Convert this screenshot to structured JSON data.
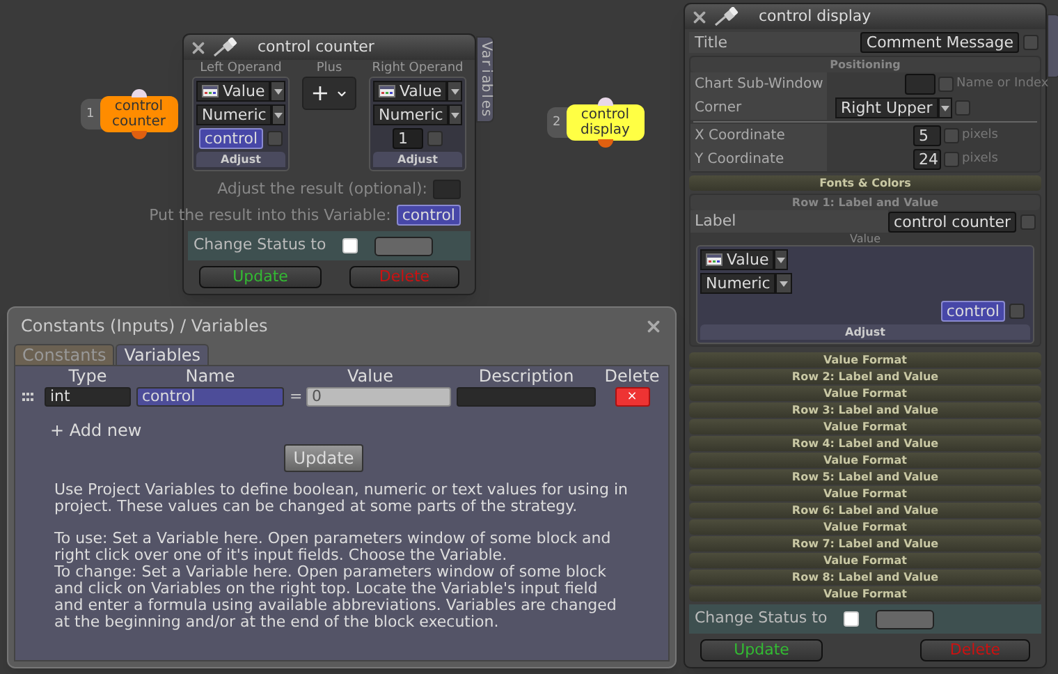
{
  "nodes": [
    {
      "number": "1",
      "label": "control counter",
      "color": "#ff8c00"
    },
    {
      "number": "2",
      "label": "control display",
      "color": "#ffff44"
    }
  ],
  "counter_window": {
    "title": "control counter",
    "side_tab": "Variables",
    "left_operand": {
      "heading": "Left Operand",
      "source": "Value",
      "type": "Numeric",
      "value": "control",
      "kind": "variable",
      "checked": false,
      "adjust": "Adjust"
    },
    "operation": {
      "heading": "Plus",
      "symbol": "+"
    },
    "right_operand": {
      "heading": "Right Operand",
      "source": "Value",
      "type": "Numeric",
      "value": "1",
      "kind": "number",
      "checked": false,
      "adjust": "Adjust"
    },
    "adjust_label": "Adjust the result (optional):",
    "result_label": "Put the result into this Variable:",
    "result_variable": "control",
    "status": {
      "label": "Change Status to",
      "checked": false
    },
    "buttons": [
      {
        "label": "Update",
        "kind": "update"
      },
      {
        "label": "Delete",
        "kind": "delete"
      }
    ]
  },
  "display_window": {
    "title": "control display",
    "title_row": {
      "label": "Title",
      "value": "Comment Message",
      "checked": false
    },
    "positioning": {
      "heading": "Positioning",
      "rows": [
        {
          "kind": "field",
          "label": "Chart Sub-Window",
          "checked": false,
          "hint": "Name or Index"
        },
        {
          "kind": "select",
          "label": "Corner",
          "value": "Right Upper",
          "checked": false
        },
        {
          "kind": "number",
          "label": "X Coordinate",
          "value": "5",
          "checked": false,
          "hint": "pixels"
        },
        {
          "kind": "number",
          "label": "Y Coordinate",
          "value": "24",
          "checked": false,
          "hint": "pixels"
        }
      ]
    },
    "fonts_heading": "Fonts & Colors",
    "row1": {
      "heading": "Row 1: Label and Value",
      "label": "Label",
      "label_value": "control counter",
      "checked": false,
      "value_caption": "Value",
      "source": "Value",
      "type": "Numeric",
      "variable": "control",
      "variable_checked": false,
      "adjust": "Adjust"
    },
    "sections": [
      "Value Format",
      "Row 2: Label and Value",
      "Value Format",
      "Row 3: Label and Value",
      "Value Format",
      "Row 4: Label and Value",
      "Value Format",
      "Row 5: Label and Value",
      "Value Format",
      "Row 6: Label and Value",
      "Value Format",
      "Row 7: Label and Value",
      "Value Format",
      "Row 8: Label and Value",
      "Value Format"
    ],
    "status": {
      "label": "Change Status to",
      "checked": false
    },
    "buttons": [
      {
        "label": "Update",
        "kind": "update"
      },
      {
        "label": "Delete",
        "kind": "delete"
      }
    ]
  },
  "variables_dialog": {
    "title": "Constants (Inputs) / Variables",
    "tabs": [
      {
        "label": "Constants",
        "selected": false
      },
      {
        "label": "Variables",
        "selected": true
      }
    ],
    "table": {
      "columns": [
        "Type",
        "Name",
        "Value",
        "Description",
        "Delete"
      ],
      "rows": [
        {
          "type": "int",
          "name": "control",
          "equals": "=",
          "value_placeholder": "0",
          "delete": "×"
        }
      ]
    },
    "add_new": "+ Add new",
    "update": "Update",
    "help": [
      [
        "Use Project Variables to define boolean, numeric or text values for using in project. These values can be changed at some parts of the strategy."
      ],
      [
        "To use: Set a Variable here. Open parameters window of some block and right click over one of it's input fields. Choose the Variable.",
        "To change: Set a Variable here. Open parameters window of some block and click on Variables on the right top. Locate the Variable's input field and enter a formula using available abbreviations. Variables are changed at the beginning and/or at the end of the block execution."
      ]
    ]
  }
}
